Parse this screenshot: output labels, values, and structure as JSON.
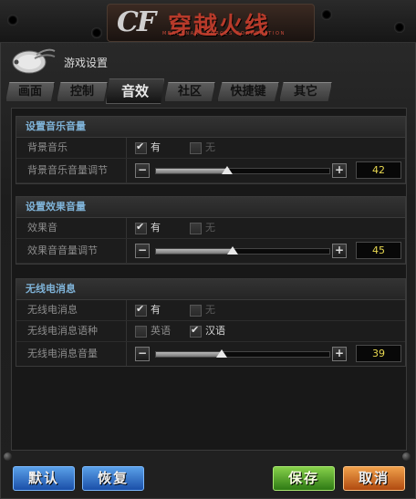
{
  "window": {
    "title": "游戏设置"
  },
  "logo": {
    "main": "穿越火线",
    "subtitle": "MERCENARY FORCES CORPORATION",
    "cf": "CF"
  },
  "tabs": [
    {
      "label": "画面",
      "active": false
    },
    {
      "label": "控制",
      "active": false
    },
    {
      "label": "音效",
      "active": true
    },
    {
      "label": "社区",
      "active": false
    },
    {
      "label": "快捷键",
      "active": false
    },
    {
      "label": "其它",
      "active": false
    }
  ],
  "music": {
    "title": "设置音乐音量",
    "enable_label": "背景音乐",
    "yes_label": "有",
    "no_label": "无",
    "enabled": true,
    "volume_label": "背景音乐音量调节",
    "volume": "42"
  },
  "effects": {
    "title": "设置效果音量",
    "enable_label": "效果音",
    "yes_label": "有",
    "no_label": "无",
    "enabled": true,
    "volume_label": "效果音音量调节",
    "volume": "45"
  },
  "radio": {
    "title": "无线电消息",
    "enable_label": "无线电消息",
    "yes_label": "有",
    "no_label": "无",
    "enabled": true,
    "language_label": "无线电消息语种",
    "lang_en": "英语",
    "lang_cn": "汉语",
    "language": "汉语",
    "volume_label": "无线电消息音量",
    "volume": "39"
  },
  "slider": {
    "minus": "−",
    "plus": "+"
  },
  "buttons": {
    "default": "默认",
    "restore": "恢复",
    "save": "保存",
    "cancel": "取消"
  },
  "colors": {
    "accent_title": "#7fb3d8",
    "value_text": "#e8d850",
    "save": "#4a9a20",
    "cancel": "#d06a20",
    "blue": "#2a6ad0"
  }
}
